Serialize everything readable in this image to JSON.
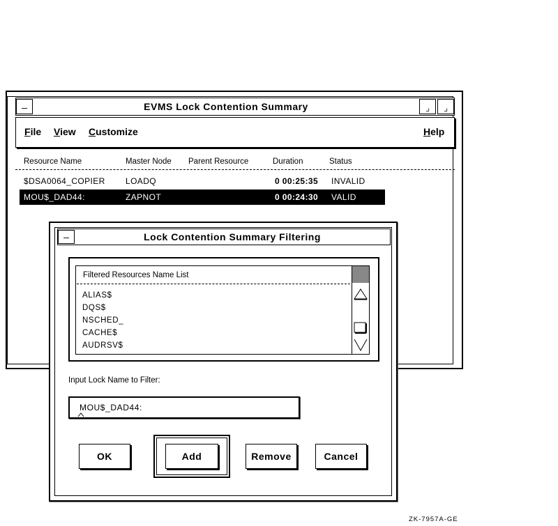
{
  "main_window": {
    "title": "EVMS Lock Contention Summary",
    "menu_button_glyph": "—",
    "minimize_glyph": "⌟",
    "maximize_glyph": "⌟",
    "menu": [
      {
        "label_first": "F",
        "label_rest": "ile"
      },
      {
        "label_first": "V",
        "label_rest": "iew"
      },
      {
        "label_first": "C",
        "label_rest": "ustomize"
      },
      {
        "label_first": "H",
        "label_rest": "elp"
      }
    ],
    "columns": [
      "Resource Name",
      "Master Node",
      "Parent Resource",
      "Duration",
      "Status"
    ],
    "rows": [
      {
        "resource": "$DSA0064_COPIER",
        "master": "LOADQ",
        "parent": "",
        "duration": "0 00:25:35",
        "status": "INVALID",
        "selected": false
      },
      {
        "resource": "MOU$_DAD44:",
        "master": "ZAPNOT",
        "parent": "",
        "duration": "0 00:24:30",
        "status": "VALID",
        "selected": true
      }
    ]
  },
  "dialog": {
    "title": "Lock Contention Summary Filtering",
    "menu_button_glyph": "—",
    "list_header": "Filtered Resources Name List",
    "list_items": [
      "ALIAS$",
      "DQS$",
      "NSCHED_",
      "CACHE$",
      "AUDRSV$"
    ],
    "input_label": "Input Lock Name to Filter:",
    "input_value": "MOU$_DAD44:",
    "buttons": {
      "ok": "OK",
      "add": "Add",
      "remove": "Remove",
      "cancel": "Cancel"
    }
  },
  "figure_id": "ZK-7957A-GE"
}
